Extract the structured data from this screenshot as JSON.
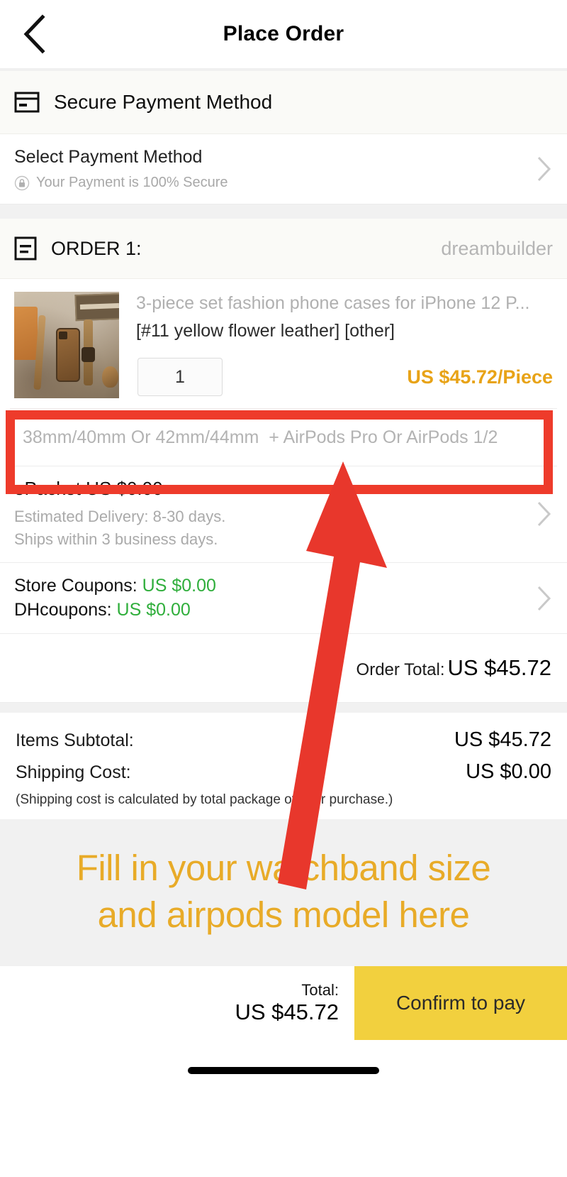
{
  "nav": {
    "title": "Place Order",
    "back_icon": "chevron-left-icon"
  },
  "payment_section": {
    "header_label": "Secure Payment Method",
    "header_icon": "credit-card-icon",
    "select_label": "Select Payment Method",
    "secure_note": "Your Payment is 100% Secure",
    "secure_icon": "lock-icon",
    "chevron_icon": "chevron-right-icon"
  },
  "order": {
    "header_icon": "order-list-icon",
    "header_label": "ORDER 1:",
    "store_name": "dreambuilder",
    "product": {
      "title": "3-piece set fashion phone cases for iPhone 12 P...",
      "attributes": "[#11 yellow flower leather] [other]",
      "quantity": "1",
      "price": "US $45.72/Piece",
      "thumbnail_alt": "leather phone case flat lay"
    },
    "custom_note": {
      "value": "",
      "placeholder": "38mm/40mm Or 42mm/44mm  + AirPods Pro Or AirPods 1/2"
    },
    "shipping": {
      "title": "ePacket US $0.00",
      "estimated_delivery": "Estimated Delivery: 8-30 days.",
      "ships_within": "Ships within 3 business days."
    },
    "coupons": {
      "store_label": "Store Coupons:",
      "store_value": "US $0.00",
      "dh_label": "DHcoupons:",
      "dh_value": "US $0.00"
    },
    "order_total_label": "Order Total:",
    "order_total_value": "US $45.72"
  },
  "summary": {
    "items_subtotal_label": "Items Subtotal:",
    "items_subtotal_value": "US $45.72",
    "shipping_cost_label": "Shipping Cost:",
    "shipping_cost_value": "US $0.00",
    "note": "(Shipping cost is calculated by total package of your purchase.)"
  },
  "annotation": {
    "banner_line1": "Fill in your watchband size",
    "banner_line2": "and airpods model here",
    "highlight_color": "#ee3b2b",
    "arrow_color": "#e8372c",
    "banner_text_color": "#e8ab28"
  },
  "pay_bar": {
    "total_label": "Total:",
    "total_value": "US $45.72",
    "confirm_label": "Confirm to pay",
    "button_color": "#f2d03e"
  }
}
